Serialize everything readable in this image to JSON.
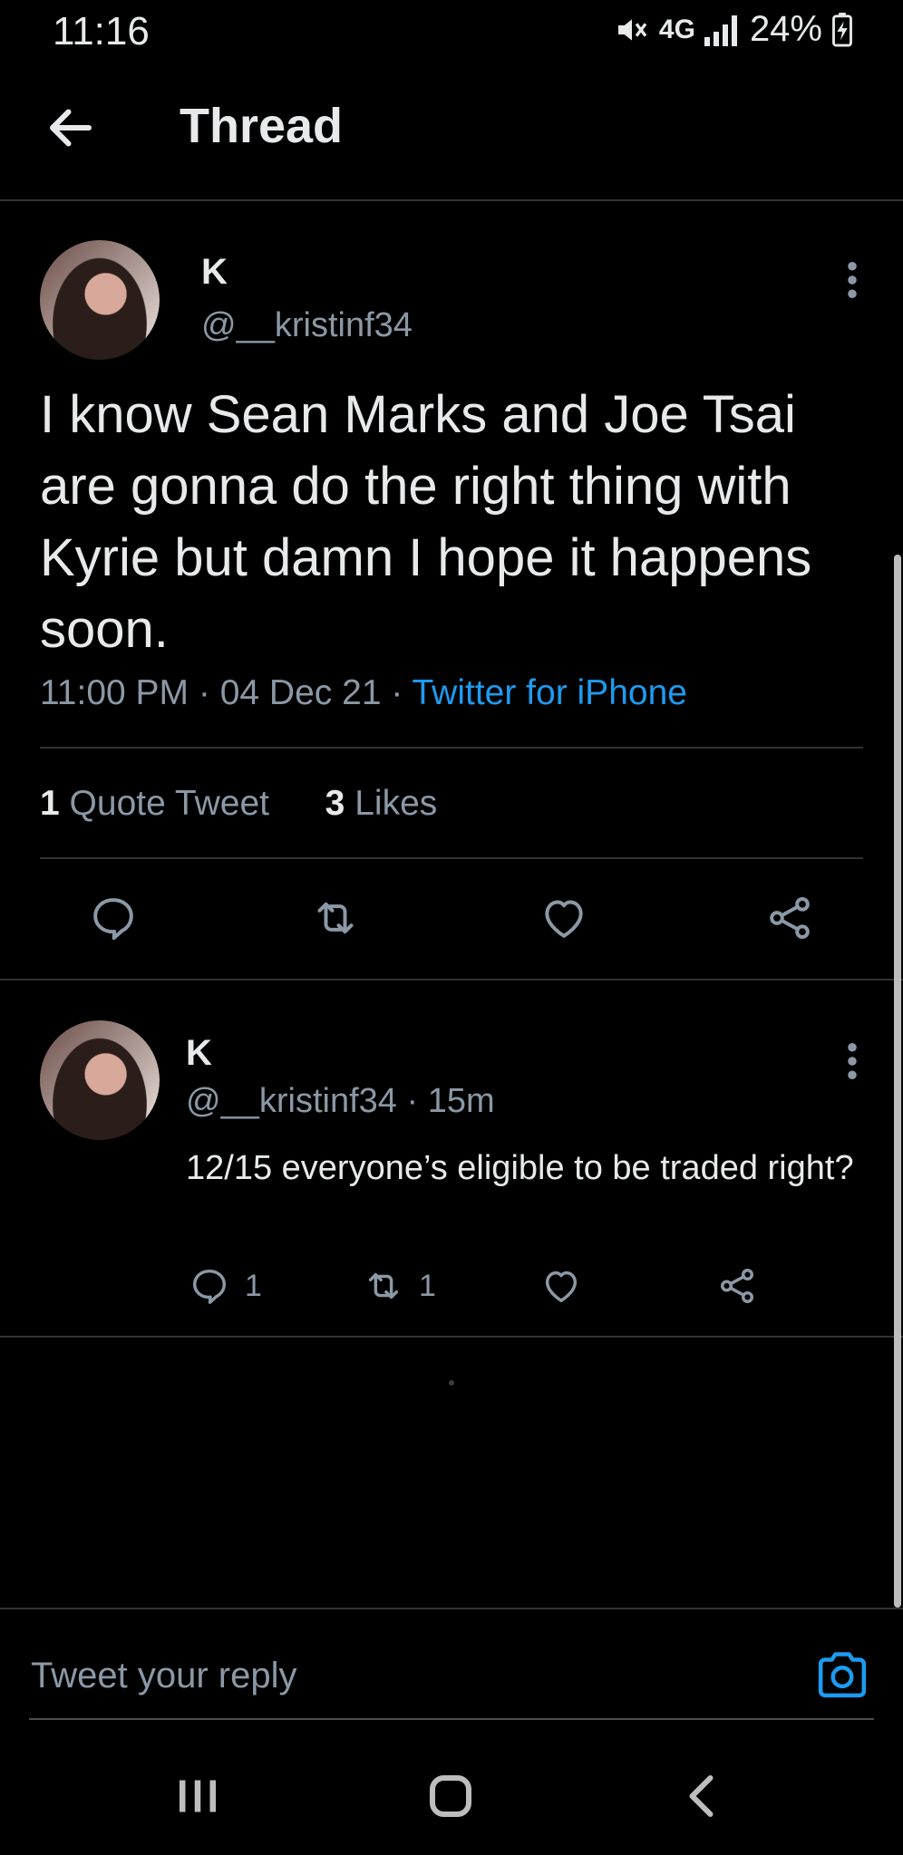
{
  "status_bar": {
    "time": "11:16",
    "network": "4G",
    "battery": "24%"
  },
  "header": {
    "title": "Thread"
  },
  "main_tweet": {
    "name": "K",
    "handle": "@__kristinf34",
    "text": "I know Sean Marks and Joe Tsai are gonna do the right thing with Kyrie but damn I hope it happens soon.",
    "time": "11:00 PM",
    "date": "04 Dec 21",
    "source": "Twitter for iPhone",
    "quote_count": "1",
    "quote_label": "Quote Tweet",
    "likes_count": "3",
    "likes_label": "Likes"
  },
  "reply_tweet": {
    "name": "K",
    "handle": "@__kristinf34",
    "age": "15m",
    "text": "12/15 everyone’s eligible to be traded right?",
    "reply_count": "1",
    "retweet_count": "1"
  },
  "compose": {
    "placeholder": "Tweet your reply"
  },
  "colors": {
    "background": "#000000",
    "accent": "#1d9bf0",
    "secondary_text": "#8b98a5",
    "divider": "#2f3336"
  }
}
